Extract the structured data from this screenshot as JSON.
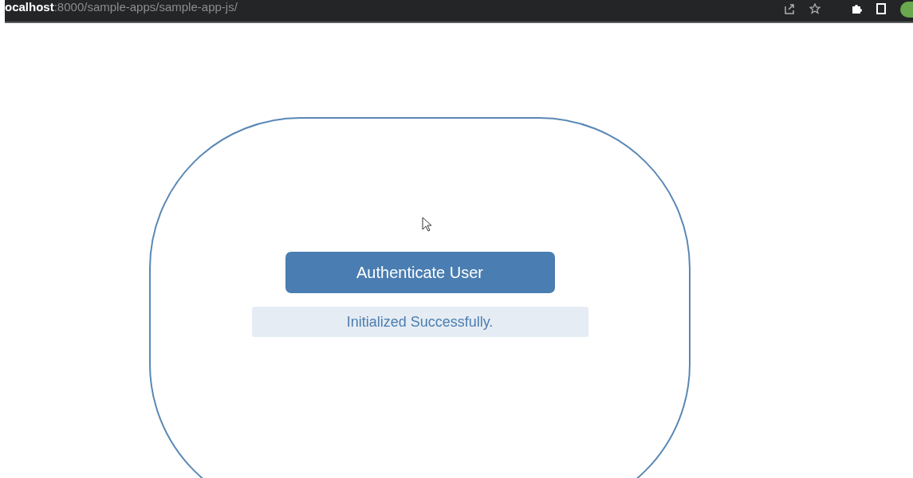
{
  "browser_bar": {
    "address": "**ocalhost**:8000/sample-apps/sample-app-js/"
  },
  "panel": {
    "button": "Authenticate User",
    "status": "Initialized Successfully."
  }
}
